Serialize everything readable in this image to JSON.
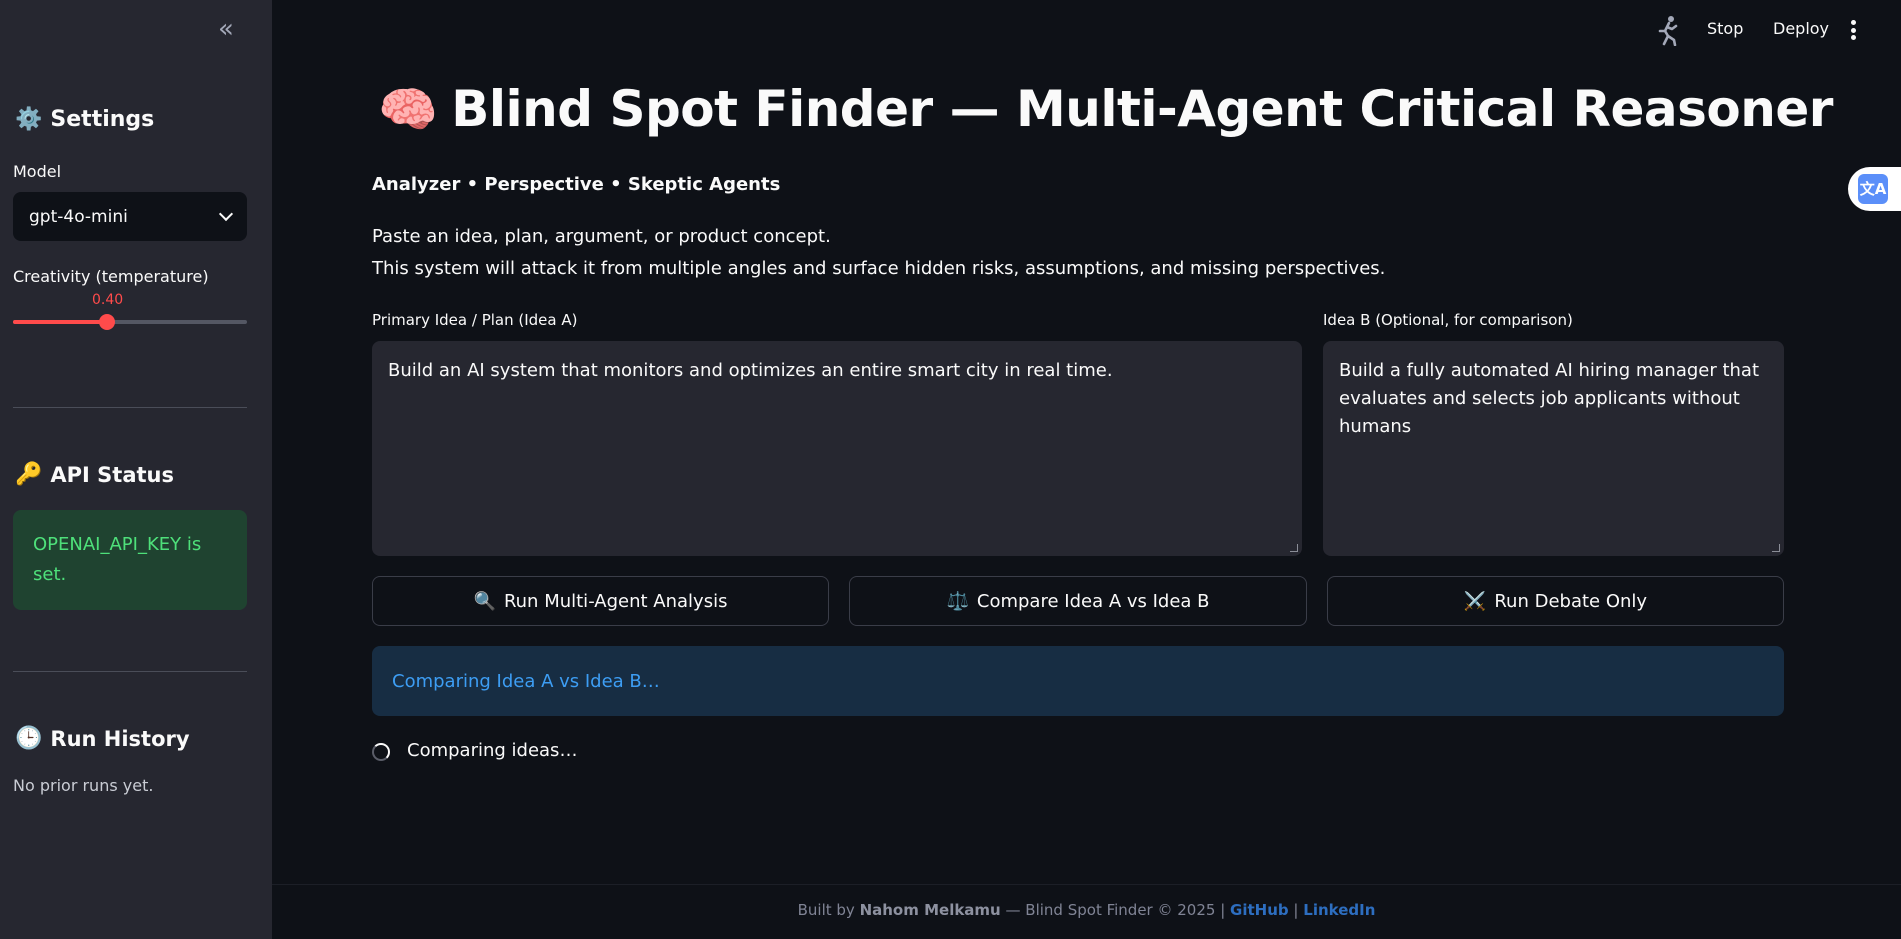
{
  "sidebar": {
    "collapse_glyph": "«",
    "settings_heading": "Settings",
    "model_label": "Model",
    "model_value": "gpt-4o-mini",
    "temperature_label": "Creativity (temperature)",
    "temperature_value": "0.40",
    "temperature_fraction": 0.4,
    "api_heading": "API Status",
    "api_status_text": "OPENAI_API_KEY is set.",
    "history_heading": "Run History",
    "history_empty": "No prior runs yet."
  },
  "topbar": {
    "stop_label": "Stop",
    "deploy_label": "Deploy"
  },
  "main": {
    "title_emoji": "🧠",
    "title": "Blind Spot Finder — Multi-Agent Critical Reasoner",
    "subtitle": "Analyzer • Perspective • Skeptic Agents",
    "desc_line1": "Paste an idea, plan, argument, or product concept.",
    "desc_line2": "This system will attack it from multiple angles and surface hidden risks, assumptions, and missing perspectives.",
    "idea_a_label": "Primary Idea / Plan (Idea A)",
    "idea_a_value": "Build an AI system that monitors and optimizes an entire smart city in real time.",
    "idea_b_label": "Idea B (Optional, for comparison)",
    "idea_b_value": "Build a fully automated AI hiring manager that evaluates and selects job applicants without humans",
    "btn_analysis": "Run Multi-Agent Analysis",
    "btn_compare": "Compare Idea A vs Idea B",
    "btn_debate": "Run Debate Only",
    "info_text": "Comparing Idea A vs Idea B…",
    "spinner_text": "Comparing ideas…"
  },
  "footer": {
    "prefix": "Built by",
    "author": "Nahom Melkamu",
    "middle": "— Blind Spot Finder © 2025 |",
    "github": "GitHub",
    "sep": "|",
    "linkedin": "LinkedIn"
  },
  "colors": {
    "accent": "#ff4b4b",
    "success_bg": "#1f4330",
    "success_text": "#4ee07a",
    "info_bg": "#172d43",
    "info_text": "#3d9df3"
  },
  "icons": {
    "settings": "gear-icon",
    "api": "key-icon",
    "history": "clock-icon",
    "analysis": "magnifier-icon",
    "compare": "scales-icon",
    "debate": "crossed-swords-icon"
  }
}
